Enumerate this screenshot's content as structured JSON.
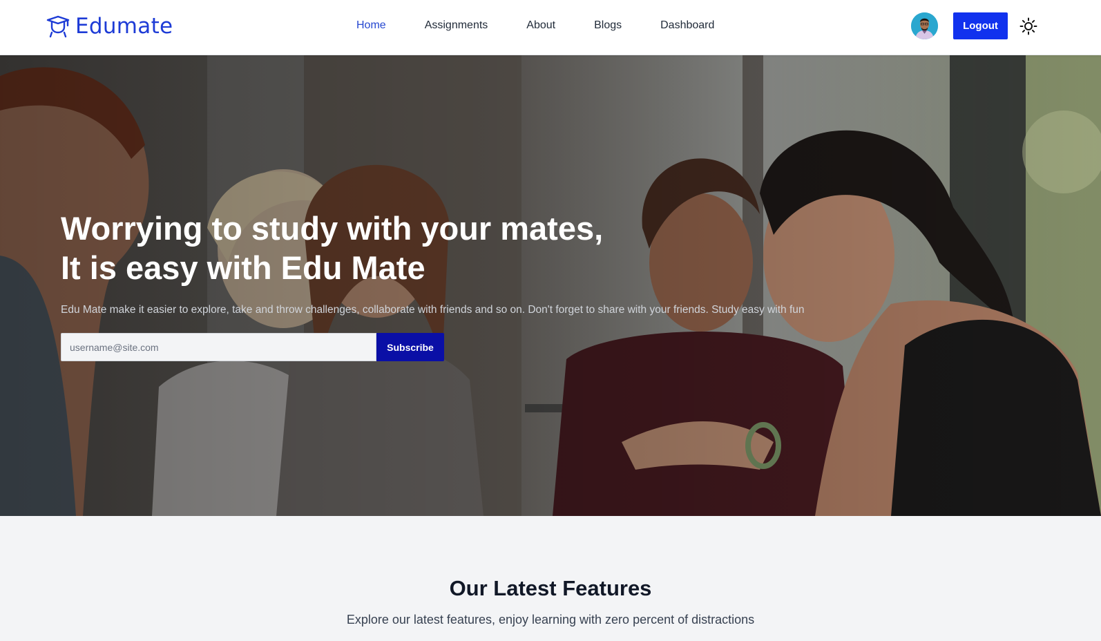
{
  "brand": {
    "name": "Edumate",
    "icon": "graduation-cap-icon",
    "color": "#1d3bd6"
  },
  "nav": {
    "links": [
      {
        "label": "Home",
        "active": true
      },
      {
        "label": "Assignments",
        "active": false
      },
      {
        "label": "About",
        "active": false
      },
      {
        "label": "Blogs",
        "active": false
      },
      {
        "label": "Dashboard",
        "active": false
      }
    ],
    "logout_label": "Logout",
    "theme_icon": "sun-icon"
  },
  "hero": {
    "title_line1": "Worrying to study with your mates,",
    "title_line2": "It is easy with Edu Mate",
    "description": "Edu Mate make it easier to explore, take and throw challenges, collaborate with friends and so on. Don't forget to share with your friends. Study easy with fun",
    "email_placeholder": "username@site.com",
    "subscribe_label": "Subscribe"
  },
  "features": {
    "title": "Our Latest Features",
    "subtitle": "Explore our latest features, enjoy learning with zero percent of distractions"
  },
  "colors": {
    "primary_button": "#1132ee",
    "subscribe_button": "#0a0fa6",
    "active_link": "#2547d0"
  }
}
